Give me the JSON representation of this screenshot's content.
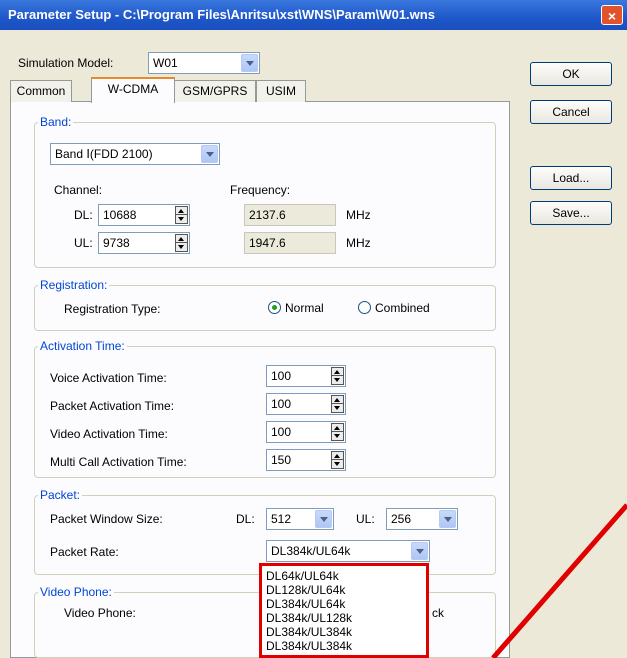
{
  "window": {
    "title": "Parameter Setup - C:\\Program Files\\Anritsu\\xst\\WNS\\Param\\W01.wns",
    "close_label": "×"
  },
  "model": {
    "label": "Simulation Model:",
    "value": "W01"
  },
  "tabs": [
    "Common",
    "W-CDMA",
    "GSM/GPRS",
    "USIM"
  ],
  "active_tab": "W-CDMA",
  "buttons": {
    "ok": "OK",
    "cancel": "Cancel",
    "load": "Load...",
    "save": "Save..."
  },
  "band": {
    "title": "Band:",
    "selected": "Band Ⅰ(FDD 2100)",
    "channel_label": "Channel:",
    "frequency_label": "Frequency:",
    "dl_label": "DL:",
    "ul_label": "UL:",
    "dl_channel": "10688",
    "ul_channel": "9738",
    "dl_freq": "2137.6",
    "ul_freq": "1947.6",
    "unit": "MHz"
  },
  "registration": {
    "title": "Registration:",
    "type_label": "Registration Type:",
    "normal": "Normal",
    "combined": "Combined",
    "selected": "Normal"
  },
  "activation": {
    "title": "Activation Time:",
    "rows": [
      {
        "label": "Voice Activation Time:",
        "value": "100"
      },
      {
        "label": "Packet Activation Time:",
        "value": "100"
      },
      {
        "label": "Video Activation Time:",
        "value": "100"
      },
      {
        "label": "Multi Call Activation Time:",
        "value": "150"
      }
    ]
  },
  "packet": {
    "title": "Packet:",
    "window_label": "Packet Window Size:",
    "dl_label": "DL:",
    "ul_label": "UL:",
    "dl_value": "512",
    "ul_value": "256",
    "rate_label": "Packet Rate:",
    "rate_value": "DL384k/UL64k",
    "options": [
      "DL64k/UL64k",
      "DL128k/UL64k",
      "DL384k/UL64k",
      "DL384k/UL128k",
      "DL384k/UL384k",
      "DL384k/UL384k"
    ]
  },
  "video": {
    "title": "Video Phone:",
    "label": "Video Phone:",
    "partial": "ck"
  },
  "colors": {
    "titlebar": "#1e57c9",
    "group_label": "#0046d5",
    "highlight": "#e00000"
  }
}
